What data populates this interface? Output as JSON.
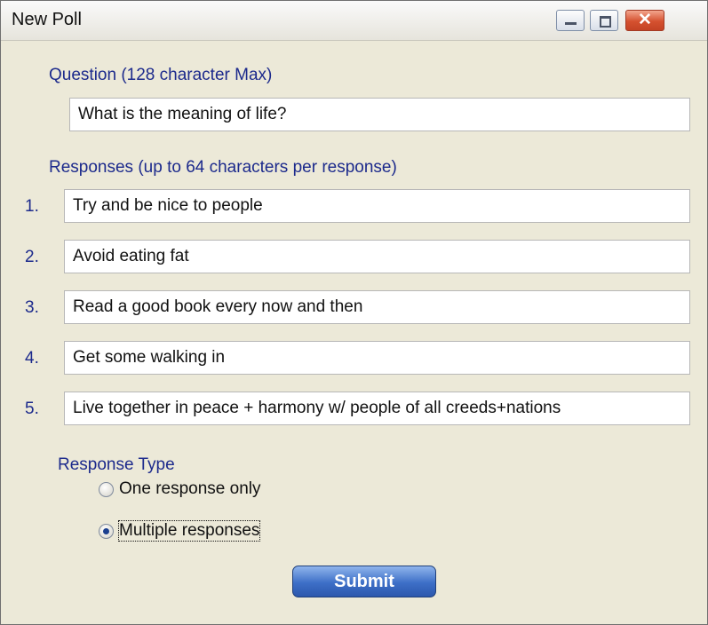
{
  "window": {
    "title": "New Poll",
    "minimize_glyph": "minimize-icon",
    "maximize_glyph": "maximize-icon",
    "close_glyph": "✕"
  },
  "question": {
    "label": "Question (128 character Max)",
    "value": "What is the meaning of life?"
  },
  "responses": {
    "label": "Responses (up to 64 characters per response)",
    "items": [
      {
        "number": "1.",
        "value": "Try and be nice to people"
      },
      {
        "number": "2.",
        "value": "Avoid eating fat"
      },
      {
        "number": "3.",
        "value": "Read a good book every now and then"
      },
      {
        "number": "4.",
        "value": "Get some walking in"
      },
      {
        "number": "5.",
        "value": "Live together in peace + harmony w/ people of all creeds+nations"
      }
    ]
  },
  "response_type": {
    "label": "Response Type",
    "options": [
      {
        "label": "One response only",
        "checked": false
      },
      {
        "label": "Multiple responses",
        "checked": true
      }
    ]
  },
  "submit_label": "Submit"
}
